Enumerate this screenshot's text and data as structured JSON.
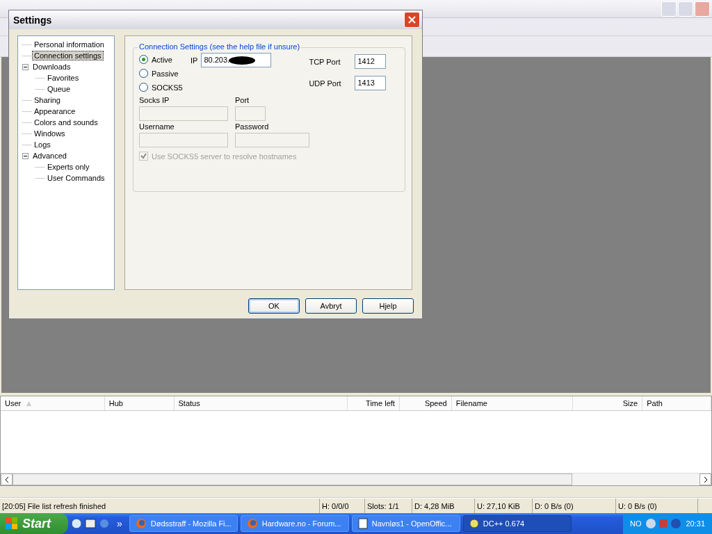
{
  "dialog": {
    "title": "Settings",
    "tree": [
      {
        "label": "Personal information",
        "selected": false
      },
      {
        "label": "Connection settings",
        "selected": true
      },
      {
        "label": "Downloads",
        "selected": false,
        "expanded": true,
        "children": [
          {
            "label": "Favorites",
            "selected": false
          },
          {
            "label": "Queue",
            "selected": false
          }
        ]
      },
      {
        "label": "Sharing",
        "selected": false
      },
      {
        "label": "Appearance",
        "selected": false
      },
      {
        "label": "Colors and sounds",
        "selected": false
      },
      {
        "label": "Windows",
        "selected": false
      },
      {
        "label": "Logs",
        "selected": false
      },
      {
        "label": "Advanced",
        "selected": false,
        "expanded": true,
        "children": [
          {
            "label": "Experts only",
            "selected": false
          },
          {
            "label": "User Commands",
            "selected": false
          }
        ]
      }
    ],
    "group_title": "Connection Settings (see the help file if unsure)",
    "modes": [
      {
        "label": "Active",
        "selected": true
      },
      {
        "label": "Passive",
        "selected": false
      },
      {
        "label": "SOCKS5",
        "selected": false
      }
    ],
    "ip": {
      "label": "IP",
      "value": "80.203."
    },
    "tcp_port": {
      "label": "TCP Port",
      "value": "1412"
    },
    "udp_port": {
      "label": "UDP Port",
      "value": "1413"
    },
    "socks_ip": {
      "label": "Socks IP",
      "disabled": true
    },
    "port": {
      "label": "Port",
      "disabled": true
    },
    "username": {
      "label": "Username",
      "disabled": true
    },
    "password": {
      "label": "Password",
      "disabled": true
    },
    "resolve": {
      "label": "Use SOCKS5 server to resolve hostnames",
      "checked": true,
      "disabled": true
    },
    "buttons": [
      {
        "label": "OK",
        "selected": true
      },
      {
        "label": "Avbryt",
        "selected": false
      },
      {
        "label": "Hjelp",
        "selected": false
      }
    ]
  },
  "transfers": {
    "columns": [
      {
        "label": "User",
        "sorted": true
      },
      {
        "label": "Hub",
        "sorted": false
      },
      {
        "label": "Status",
        "sorted": false
      },
      {
        "label": "Time left",
        "sorted": false
      },
      {
        "label": "Speed",
        "sorted": false
      },
      {
        "label": "Filename",
        "sorted": false
      },
      {
        "label": "Size",
        "sorted": false
      },
      {
        "label": "Path",
        "sorted": false
      }
    ]
  },
  "status_bar": [
    "[20:05] File list refresh finished",
    "H: 0/0/0",
    "Slots: 1/1",
    "D: 4,28 MiB",
    "U: 27,10 KiB",
    "D: 0 B/s (0)",
    "U: 0 B/s (0)"
  ],
  "taskbar": {
    "start": "Start",
    "overflow": "»",
    "tasks": [
      {
        "label": "Dødsstraff - Mozilla Fi...",
        "kind": "browser",
        "selected": false
      },
      {
        "label": "Hardware.no - Forum...",
        "kind": "browser",
        "selected": false
      },
      {
        "label": "Navnløs1 - OpenOffic...",
        "kind": "document",
        "selected": false
      },
      {
        "label": "DC++ 0.674",
        "kind": "dc",
        "selected": true
      }
    ],
    "language": "NO",
    "time": "20:31"
  }
}
